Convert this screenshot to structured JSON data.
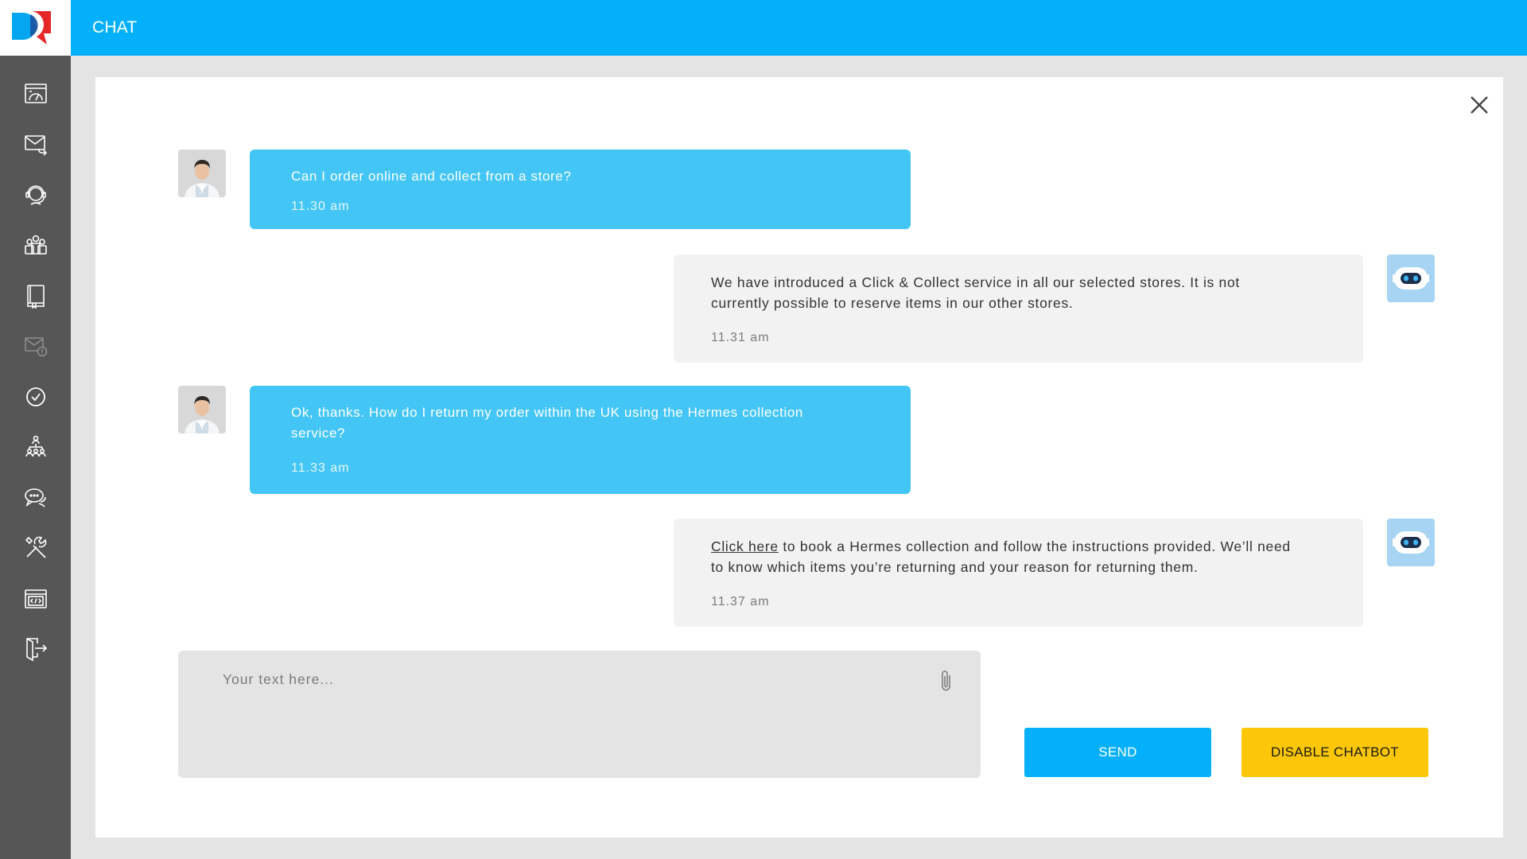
{
  "app": {
    "title": "CHAT",
    "brand_color": "#04b0fa",
    "accent_color": "#fcc709"
  },
  "sidebar": {
    "items": [
      {
        "icon": "dashboard-icon"
      },
      {
        "icon": "mail-reply-icon"
      },
      {
        "icon": "agent-headset-icon"
      },
      {
        "icon": "team-icon"
      },
      {
        "icon": "knowledge-book-icon"
      },
      {
        "icon": "mail-alert-icon",
        "disabled": true
      },
      {
        "icon": "check-circle-icon"
      },
      {
        "icon": "hierarchy-icon"
      },
      {
        "icon": "chat-icon"
      },
      {
        "icon": "tools-icon"
      },
      {
        "icon": "code-window-icon"
      },
      {
        "icon": "logout-icon"
      }
    ]
  },
  "messages": [
    {
      "sender": "user",
      "lines": [
        "Can I order online and collect from a store?"
      ],
      "time": "11.30 am"
    },
    {
      "sender": "bot",
      "lines": [
        "We have introduced a Click & Collect service in all our selected stores. It is not",
        "currently possible to reserve items in our other stores."
      ],
      "time": "11.31 am"
    },
    {
      "sender": "user",
      "lines": [
        "Ok, thanks. How do I return my order within the UK using the Hermes collection",
        "service?"
      ],
      "time": "11.33 am"
    },
    {
      "sender": "bot",
      "link_text": "Click here",
      "lines": [
        " to book a Hermes collection and follow the instructions provided. We’ll need",
        "to know which items you’re returning and your reason for returning them."
      ],
      "time": "11.37 am"
    }
  ],
  "composer": {
    "placeholder": "Your text here...",
    "value": ""
  },
  "actions": {
    "send_label": "SEND",
    "disable_chatbot_label": "DISABLE CHATBOT"
  }
}
